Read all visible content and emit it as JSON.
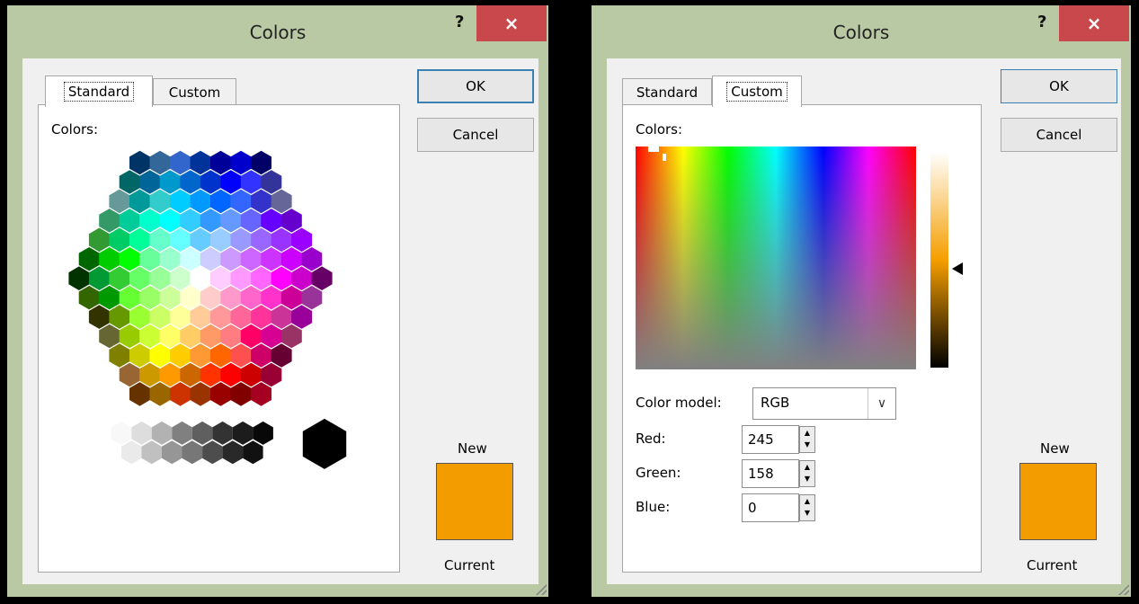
{
  "left_dialog": {
    "title": "Colors",
    "help": "?",
    "close": "×",
    "tabs": [
      "Standard",
      "Custom"
    ],
    "active_tab": "Standard",
    "colors_label": "Colors:",
    "ok": "OK",
    "cancel": "Cancel",
    "new_label": "New",
    "current_label": "Current",
    "new_color": "#f39c00"
  },
  "right_dialog": {
    "title": "Colors",
    "help": "?",
    "close": "×",
    "tabs": [
      "Standard",
      "Custom"
    ],
    "active_tab": "Custom",
    "colors_label": "Colors:",
    "color_model_label": "Color model:",
    "color_model_value": "RGB",
    "red_label": "Red:",
    "red_value": "245",
    "green_label": "Green:",
    "green_value": "158",
    "blue_label": "Blue:",
    "blue_value": "0",
    "ok": "OK",
    "cancel": "Cancel",
    "new_label": "New",
    "current_label": "Current",
    "new_color": "#f39c00"
  },
  "hex_palette": {
    "rows": [
      [
        "#003366",
        "#336699",
        "#3366cc",
        "#003399",
        "#000099",
        "#0000cc",
        "#000066"
      ],
      [
        "#006666",
        "#006699",
        "#0099cc",
        "#0066cc",
        "#0033cc",
        "#0000ff",
        "#3333ff",
        "#333399"
      ],
      [
        "#669999",
        "#009999",
        "#33cccc",
        "#00ccff",
        "#0099ff",
        "#0066ff",
        "#3366ff",
        "#3333cc",
        "#666699"
      ],
      [
        "#339966",
        "#00cc99",
        "#00ffcc",
        "#00ffff",
        "#33ccff",
        "#3399ff",
        "#6699ff",
        "#6666ff",
        "#6600ff",
        "#6600cc"
      ],
      [
        "#339933",
        "#00cc66",
        "#00ff99",
        "#66ffcc",
        "#66ffff",
        "#66ccff",
        "#99ccff",
        "#9999ff",
        "#9966ff",
        "#9933ff",
        "#9900ff"
      ],
      [
        "#006600",
        "#00cc00",
        "#00ff00",
        "#66ff99",
        "#99ffcc",
        "#ccffff",
        "#ccccff",
        "#cc99ff",
        "#cc66ff",
        "#cc33ff",
        "#cc00ff",
        "#9900cc"
      ],
      [
        "#003300",
        "#009933",
        "#33cc33",
        "#66ff66",
        "#99ff99",
        "#ccffcc",
        "#ffffff",
        "#ffccff",
        "#ff99ff",
        "#ff66ff",
        "#ff00ff",
        "#cc00cc",
        "#660066"
      ],
      [
        "#336600",
        "#009900",
        "#66ff33",
        "#99ff66",
        "#ccff99",
        "#ffffcc",
        "#ffcccc",
        "#ff99cc",
        "#ff66cc",
        "#ff33cc",
        "#cc0099",
        "#993399"
      ],
      [
        "#333300",
        "#669900",
        "#99ff33",
        "#ccff66",
        "#ffff99",
        "#ffcc99",
        "#ff9999",
        "#ff6699",
        "#ff3399",
        "#cc3399",
        "#990099"
      ],
      [
        "#666633",
        "#99cc00",
        "#ccff33",
        "#ffff66",
        "#ffcc66",
        "#ff9966",
        "#ff7c80",
        "#ff0066",
        "#d60093",
        "#993366"
      ],
      [
        "#808000",
        "#cccc00",
        "#ffff00",
        "#ffcc00",
        "#ff9933",
        "#ff6600",
        "#ff5050",
        "#cc0066",
        "#660033"
      ],
      [
        "#996633",
        "#cc9900",
        "#ff9900",
        "#cc6600",
        "#ff3300",
        "#ff0000",
        "#cc0000",
        "#990033"
      ],
      [
        "#663300",
        "#996600",
        "#cc3300",
        "#993300",
        "#990000",
        "#800000",
        "#a50021"
      ]
    ],
    "grays_top": [
      "#f8f8f8",
      "#dddddd",
      "#b2b2b2",
      "#808080",
      "#5f5f5f",
      "#333333",
      "#1c1c1c",
      "#080808"
    ],
    "grays_bottom": [
      "#eaeaea",
      "#c0c0c0",
      "#969696",
      "#777777",
      "#4d4d4d",
      "#292929",
      "#111111"
    ],
    "big_black": "#000000"
  }
}
